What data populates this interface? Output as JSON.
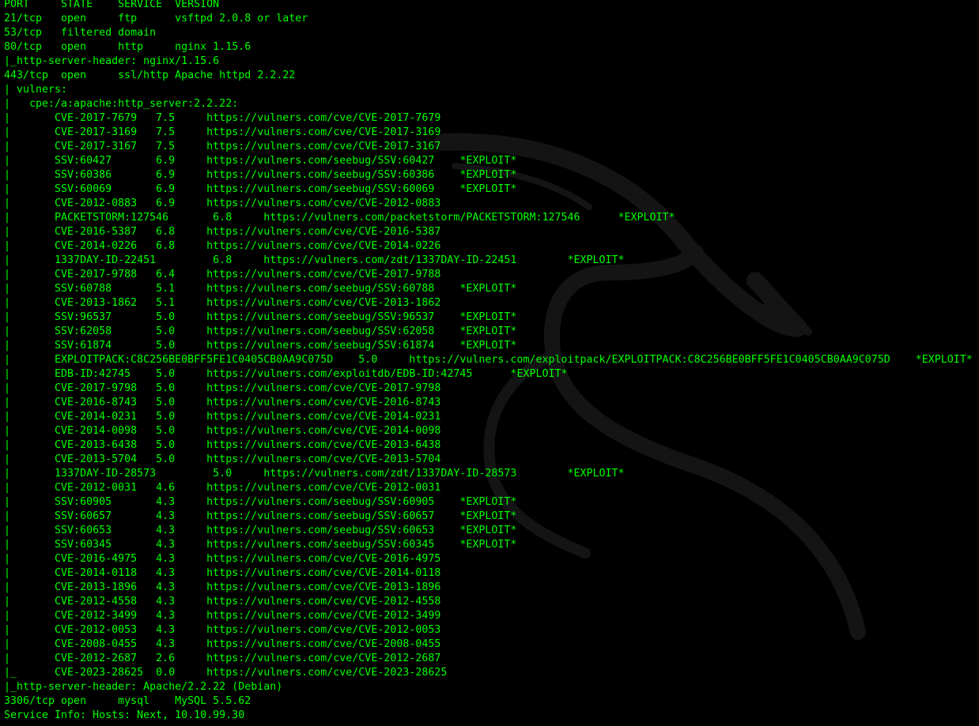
{
  "terminal": {
    "text_color": "#00ff00",
    "background_color": "#000000",
    "watermark": "kali-dragon-logo",
    "lines": [
      "PORT     STATE    SERVICE  VERSION",
      "21/tcp   open     ftp      vsftpd 2.0.8 or later",
      "53/tcp   filtered domain",
      "80/tcp   open     http     nginx 1.15.6",
      "|_http-server-header: nginx/1.15.6",
      "443/tcp  open     ssl/http Apache httpd 2.2.22",
      "| vulners:",
      "|   cpe:/a:apache:http_server:2.2.22:",
      "|       CVE-2017-7679   7.5     https://vulners.com/cve/CVE-2017-7679",
      "|       CVE-2017-3169   7.5     https://vulners.com/cve/CVE-2017-3169",
      "|       CVE-2017-3167   7.5     https://vulners.com/cve/CVE-2017-3167",
      "|       SSV:60427       6.9     https://vulners.com/seebug/SSV:60427    *EXPLOIT*",
      "|       SSV:60386       6.9     https://vulners.com/seebug/SSV:60386    *EXPLOIT*",
      "|       SSV:60069       6.9     https://vulners.com/seebug/SSV:60069    *EXPLOIT*",
      "|       CVE-2012-0883   6.9     https://vulners.com/cve/CVE-2012-0883",
      "|       PACKETSTORM:127546       6.8     https://vulners.com/packetstorm/PACKETSTORM:127546      *EXPLOIT*",
      "|       CVE-2016-5387   6.8     https://vulners.com/cve/CVE-2016-5387",
      "|       CVE-2014-0226   6.8     https://vulners.com/cve/CVE-2014-0226",
      "|       1337DAY-ID-22451         6.8     https://vulners.com/zdt/1337DAY-ID-22451        *EXPLOIT*",
      "|       CVE-2017-9788   6.4     https://vulners.com/cve/CVE-2017-9788",
      "|       SSV:60788       5.1     https://vulners.com/seebug/SSV:60788    *EXPLOIT*",
      "|       CVE-2013-1862   5.1     https://vulners.com/cve/CVE-2013-1862",
      "|       SSV:96537       5.0     https://vulners.com/seebug/SSV:96537    *EXPLOIT*",
      "|       SSV:62058       5.0     https://vulners.com/seebug/SSV:62058    *EXPLOIT*",
      "|       SSV:61874       5.0     https://vulners.com/seebug/SSV:61874    *EXPLOIT*",
      "|       EXPLOITPACK:C8C256BE0BFF5FE1C0405CB0AA9C075D    5.0     https://vulners.com/exploitpack/EXPLOITPACK:C8C256BE0BFF5FE1C0405CB0AA9C075D    *EXPLOIT*",
      "|       EDB-ID:42745    5.0     https://vulners.com/exploitdb/EDB-ID:42745      *EXPLOIT*",
      "|       CVE-2017-9798   5.0     https://vulners.com/cve/CVE-2017-9798",
      "|       CVE-2016-8743   5.0     https://vulners.com/cve/CVE-2016-8743",
      "|       CVE-2014-0231   5.0     https://vulners.com/cve/CVE-2014-0231",
      "|       CVE-2014-0098   5.0     https://vulners.com/cve/CVE-2014-0098",
      "|       CVE-2013-6438   5.0     https://vulners.com/cve/CVE-2013-6438",
      "|       CVE-2013-5704   5.0     https://vulners.com/cve/CVE-2013-5704",
      "|       1337DAY-ID-28573         5.0     https://vulners.com/zdt/1337DAY-ID-28573        *EXPLOIT*",
      "|       CVE-2012-0031   4.6     https://vulners.com/cve/CVE-2012-0031",
      "|       SSV:60905       4.3     https://vulners.com/seebug/SSV:60905    *EXPLOIT*",
      "|       SSV:60657       4.3     https://vulners.com/seebug/SSV:60657    *EXPLOIT*",
      "|       SSV:60653       4.3     https://vulners.com/seebug/SSV:60653    *EXPLOIT*",
      "|       SSV:60345       4.3     https://vulners.com/seebug/SSV:60345    *EXPLOIT*",
      "|       CVE-2016-4975   4.3     https://vulners.com/cve/CVE-2016-4975",
      "|       CVE-2014-0118   4.3     https://vulners.com/cve/CVE-2014-0118",
      "|       CVE-2013-1896   4.3     https://vulners.com/cve/CVE-2013-1896",
      "|       CVE-2012-4558   4.3     https://vulners.com/cve/CVE-2012-4558",
      "|       CVE-2012-3499   4.3     https://vulners.com/cve/CVE-2012-3499",
      "|       CVE-2012-0053   4.3     https://vulners.com/cve/CVE-2012-0053",
      "|       CVE-2008-0455   4.3     https://vulners.com/cve/CVE-2008-0455",
      "|       CVE-2012-2687   2.6     https://vulners.com/cve/CVE-2012-2687",
      "|_      CVE-2023-28625  0.0     https://vulners.com/cve/CVE-2023-28625",
      "|_http-server-header: Apache/2.2.22 (Debian)",
      "3306/tcp open     mysql    MySQL 5.5.62",
      "Service Info: Hosts: Next, 10.10.99.30"
    ]
  }
}
